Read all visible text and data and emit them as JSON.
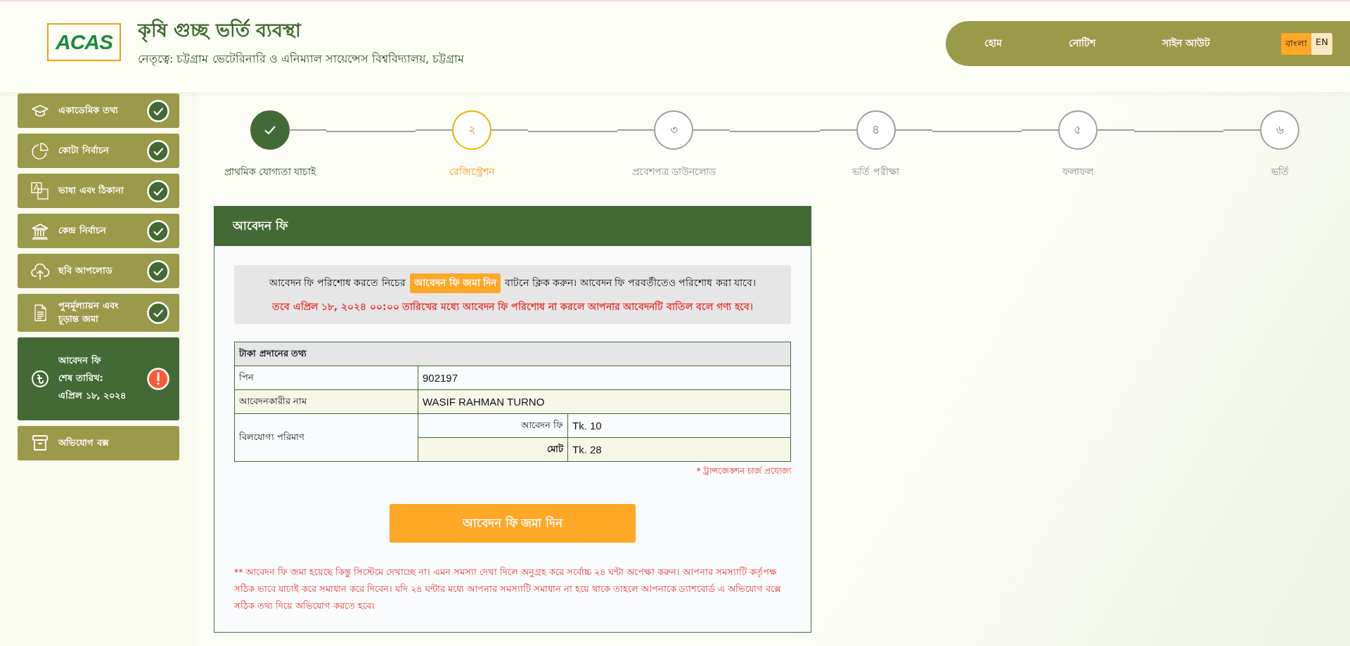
{
  "header": {
    "logo": "ACAS",
    "title": "কৃষি গুচ্ছ ভর্তি ব্যবস্থা",
    "subtitle": "নেতৃত্বে: চট্টগ্রাম ভেটেরিনারি ও এনিম্যাল সায়েন্সেস বিশ্ববিদ্যালয়, চট্টগ্রাম"
  },
  "nav": {
    "links": [
      "হোম",
      "নোটিশ",
      "সাইন আউট"
    ],
    "languages": [
      {
        "label": "বাংলা",
        "selected": true
      },
      {
        "label": "EN",
        "selected": false
      }
    ]
  },
  "sidebar": {
    "items": [
      {
        "label": "একাডেমিক তথ্য",
        "completed": true,
        "warning": false,
        "selected": false
      },
      {
        "label": "কোটা নির্বাচন",
        "completed": true,
        "warning": false,
        "selected": false
      },
      {
        "label": "ভাষা এবং ঠিকানা",
        "completed": true,
        "warning": false,
        "selected": false
      },
      {
        "label": "কেন্দ্র নির্বাচন",
        "completed": true,
        "warning": false,
        "selected": false
      },
      {
        "label": "ছবি আপলোড",
        "completed": true,
        "warning": false,
        "selected": false
      },
      {
        "label": "পুনর্মূল্যায়ন এবং চূড়ান্ত জমা",
        "completed": true,
        "warning": false,
        "selected": false
      },
      {
        "label": "আবেদন ফি",
        "details": [
          "শেষ তারিখ:",
          "এপ্রিল ১৮, ২০২৪"
        ],
        "completed": false,
        "warning": true,
        "selected": true
      },
      {
        "label": "অভিযোগ বক্স",
        "completed": false,
        "warning": false,
        "selected": false
      }
    ]
  },
  "steps": [
    {
      "label": "প্রাথমিক যোগ্যতা যাচাই",
      "completed": true,
      "current": false
    },
    {
      "number": "২",
      "label": "রেজিস্ট্রেশন",
      "completed": false,
      "current": true
    },
    {
      "number": "৩",
      "label": "প্রবেশপত্র ডাউনলোড",
      "completed": false,
      "current": false
    },
    {
      "number": "৪",
      "label": "ভর্তি পরীক্ষা",
      "completed": false,
      "current": false
    },
    {
      "number": "৫",
      "label": "ফলাফল",
      "completed": false,
      "current": false
    },
    {
      "number": "৬",
      "label": "ভর্তি",
      "completed": false,
      "current": false
    }
  ],
  "card": {
    "title": "আবেদন ফি",
    "notice": {
      "before": "আবেদন ফি পরিশোধ করতে নিচের",
      "highlight": "আবেদন ফি জমা দিন",
      "after": "বাটনে ক্লিক করুন। আবেদন ফি পরবর্তীতেও পরিশোধ করা যাবে।",
      "warning": "তবে এপ্রিল ১৮, ২০২৪ ০০:০০ তারিখের মধ্যে আবেদন ফি পরিশোধ না করলে আপনার আবেদনটি বাতিল বলে গণ্য হবে।"
    },
    "table": {
      "title": "টাকা প্রদানের তথ্য",
      "rows": [
        {
          "label": "পিন",
          "value": "902197"
        },
        {
          "label": "আবেদনকারীর নাম",
          "value": "WASIF RAHMAN TURNO"
        }
      ],
      "amount": {
        "label": "বিলযোগ্য পরিমাণ",
        "items": [
          {
            "label": "আবেদন ফি",
            "value": "Tk. 10",
            "bold": false
          },
          {
            "label": "মোট",
            "value": "Tk. 28",
            "bold": true
          }
        ]
      }
    },
    "table_note": "* ট্রান্সজেকশন চার্জ প্রযোজ্য",
    "button": "আবেদন ফি জমা দিন",
    "footnote": "** আবেদন ফি জমা হয়েছে কিন্তু সিস্টেমে দেখাচ্ছে না। এমন সমস্যা দেখা দিলে অনুগ্রহ করে সর্বোচ্চ ২৪ ঘন্টা অপেক্ষা করুন। আপনার সমস্যাটি কর্তৃপক্ষ সঠিক ভাবে যাচাই করে সমাধান করে দিবেন। যদি ২৪ ঘন্টার মধ্যে আপনার সমস্যাটি সমাধান না হয়ে থাকে তাহলে আপনাকে ড্যাশবোর্ড এ অভিযোগ বক্সে সঠিক তথ্য দিয়ে অভিযোগ করতে হবে।"
  }
}
